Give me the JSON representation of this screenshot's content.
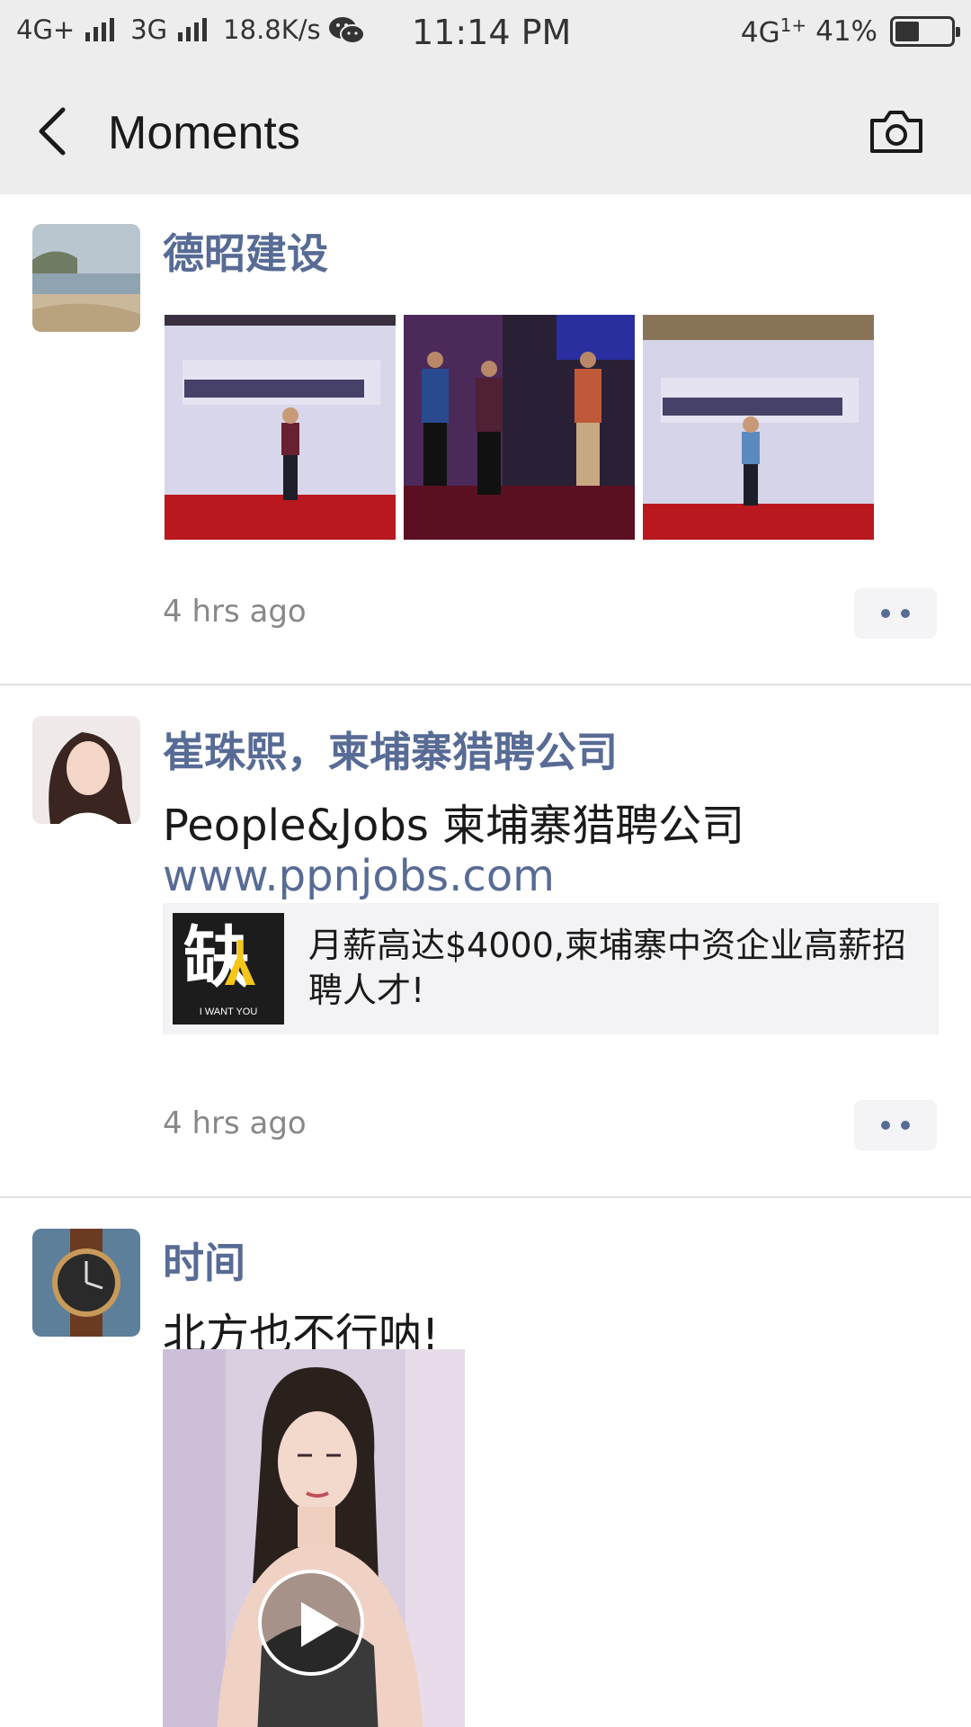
{
  "status_bar": {
    "network1": "4G+",
    "network2": "3G",
    "speed": "18.8K/s",
    "time": "11:14 PM",
    "network3": "4G",
    "battery": "41%",
    "icons": [
      "signal-icon",
      "wechat-icon",
      "battery-icon"
    ]
  },
  "nav": {
    "title": "Moments",
    "icons": [
      "back-arrow-icon",
      "camera-icon"
    ]
  },
  "posts": [
    {
      "name": "德昭建设",
      "time": "4 hrs ago",
      "photo_count": 3
    },
    {
      "name": "崔珠熙，柬埔寨猎聘公司",
      "text": "People&Jobs 柬埔寨猎聘公司",
      "link": "www.ppnjobs.com",
      "card_thumb_text": "I WANT YOU",
      "card_text": "月薪高达$4000,柬埔寨中资企业高薪招聘人才!",
      "time": "4 hrs ago"
    },
    {
      "name": "时间",
      "text": "北方也不行呐!"
    }
  ],
  "colors": {
    "name_blue": "#576b95",
    "header_bg": "#ededed",
    "card_bg": "#f3f3f5"
  }
}
